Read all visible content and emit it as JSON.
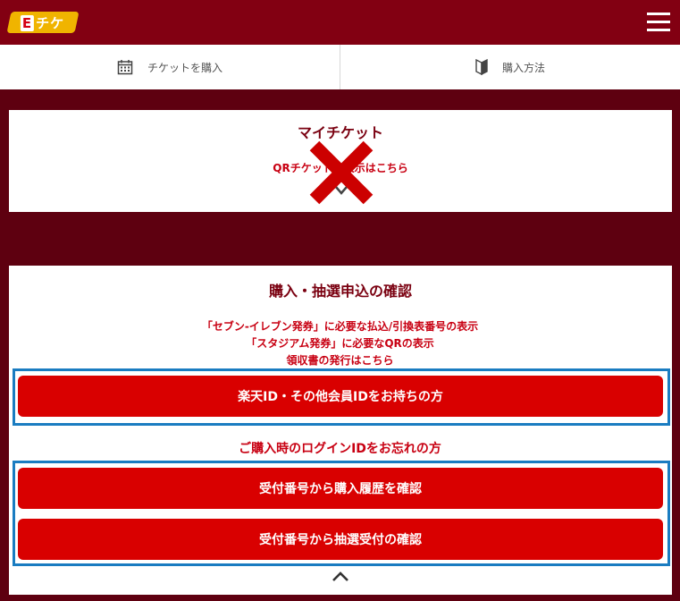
{
  "header": {
    "logo_text": "チケ",
    "logo_letter": "E",
    "menu_icon": "hamburger-icon"
  },
  "tabs": [
    {
      "label": "チケットを購入",
      "icon": "calendar-icon"
    },
    {
      "label": "購入方法",
      "icon": "beginner-mark-icon"
    }
  ],
  "my_ticket": {
    "title": "マイチケット",
    "link": "QRチケットの表示はこちら",
    "overlay_icon": "x-mark-icon",
    "expand_icon": "chevron-down-icon"
  },
  "confirm": {
    "title": "購入・抽選申込の確認",
    "notes": [
      "「セブン-イレブン発券」に必要な払込/引換表番号の表示",
      "「スタジアム発券」に必要なQRの表示",
      "領収書の発行はこちら"
    ],
    "rakuten_button": "楽天ID・その他会員IDをお持ちの方",
    "forgot_text": "ご購入時のログインIDをお忘れの方",
    "history_button": "受付番号から購入履歴を確認",
    "lottery_button": "受付番号から抽選受付の確認",
    "collapse_icon": "chevron-up-icon"
  },
  "colors": {
    "header_bg": "#820012",
    "page_bg": "#5e0010",
    "button_red": "#d90000",
    "highlight_blue": "#1a7cc1",
    "logo_yellow": "#f0b400"
  }
}
